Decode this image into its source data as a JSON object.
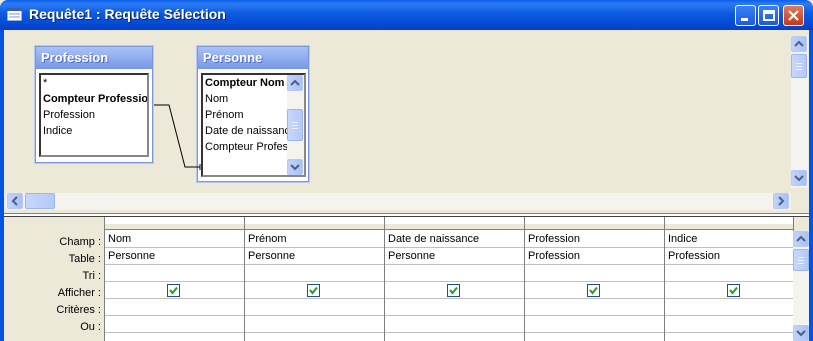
{
  "window": {
    "title": "Requête1 : Requête Sélection"
  },
  "tables": [
    {
      "name": "Profession",
      "fields": [
        "*",
        "Compteur Profession",
        "Profession",
        "Indice"
      ]
    },
    {
      "name": "Personne",
      "fields": [
        "Compteur Nom",
        "Nom",
        "Prénom",
        "Date de naissance",
        "Compteur Profession"
      ]
    }
  ],
  "grid": {
    "row_labels": [
      "Champ :",
      "Table :",
      "Tri :",
      "Afficher :",
      "Critères :",
      "Ou :"
    ],
    "columns": [
      {
        "field": "Nom",
        "table": "Personne",
        "show": true
      },
      {
        "field": "Prénom",
        "table": "Personne",
        "show": true
      },
      {
        "field": "Date de naissance",
        "table": "Personne",
        "show": true
      },
      {
        "field": "Profession",
        "table": "Profession",
        "show": true
      },
      {
        "field": "Indice",
        "table": "Profession",
        "show": true
      }
    ]
  },
  "colors": {
    "titlebar": "#0054E3",
    "check": "#21A121",
    "table_header": "#7898E8"
  }
}
